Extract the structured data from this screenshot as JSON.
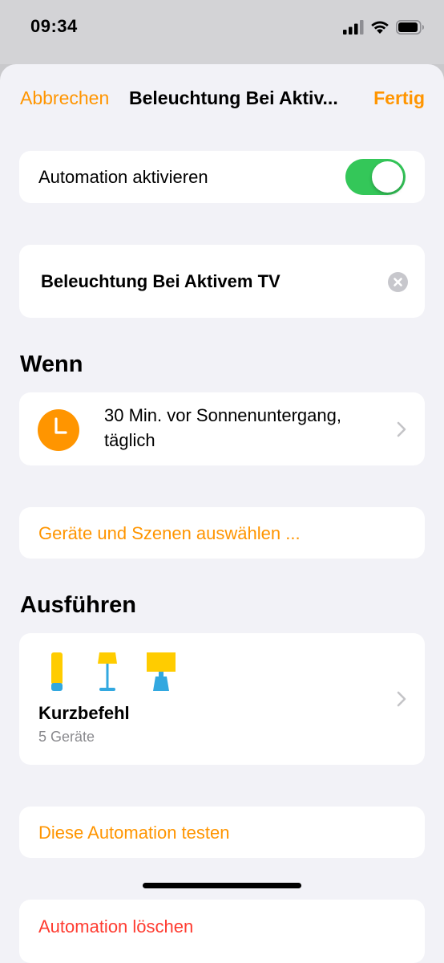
{
  "status_bar": {
    "time": "09:34"
  },
  "nav": {
    "cancel_label": "Abbrechen",
    "title": "Beleuchtung Bei Aktiv...",
    "done_label": "Fertig"
  },
  "enable_row": {
    "label": "Automation aktivieren",
    "enabled": true
  },
  "name_field": {
    "value": "Beleuchtung Bei Aktivem TV"
  },
  "when_section": {
    "heading": "Wenn",
    "trigger_line1": "30 Min. vor Sonnenuntergang,",
    "trigger_line2": "täglich"
  },
  "select_devices": {
    "label": "Geräte und Szenen auswählen ..."
  },
  "run_section": {
    "heading": "Ausführen",
    "title": "Kurzbefehl",
    "subtitle": "5 Geräte",
    "icons": [
      "lightstrip-icon",
      "floor-lamp-icon",
      "table-lamp-icon"
    ]
  },
  "test_action": {
    "label": "Diese Automation testen"
  },
  "delete_action": {
    "label": "Automation löschen"
  },
  "colors": {
    "accent": "#ff9500",
    "toggle_on": "#34c759",
    "destructive": "#ff3b30",
    "lamp_yellow": "#ffcc00",
    "lamp_blue": "#32a8e0"
  }
}
